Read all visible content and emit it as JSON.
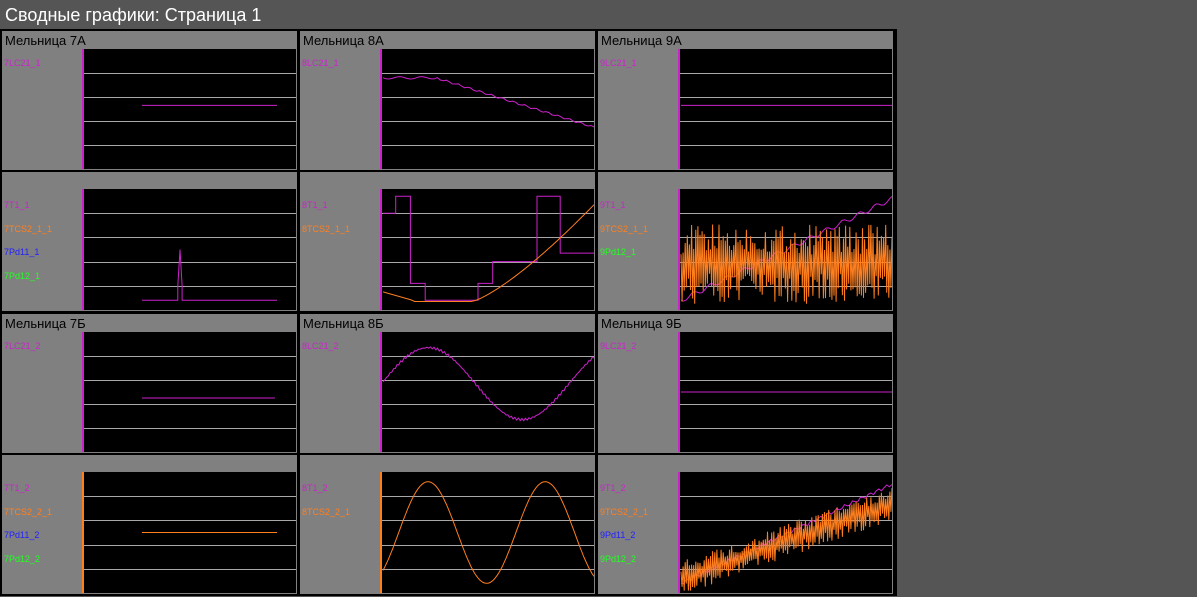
{
  "page": {
    "title": "Сводные графики: Страница 1"
  },
  "colors": {
    "background": "#555555",
    "panel": "#808080",
    "plot": "#000000",
    "grid": "#a8a8a8",
    "magenta": "#cc22cc",
    "orange": "#ff7f1f",
    "blue": "#2020ff",
    "green": "#22ff22"
  },
  "panels": [
    {
      "title": "Мельница 7А",
      "labels": [
        {
          "text": "7LC21_1",
          "color": "magenta"
        }
      ]
    },
    {
      "title": "Мельница 8А",
      "labels": [
        {
          "text": "8LC21_1",
          "color": "magenta"
        }
      ]
    },
    {
      "title": "Мельница 9А",
      "labels": [
        {
          "text": "9LC21_1",
          "color": "magenta"
        }
      ]
    },
    {
      "title": "",
      "labels": [
        {
          "text": "7T1_1",
          "color": "magenta"
        },
        {
          "text": "7TCS2_1_1",
          "color": "orange"
        },
        {
          "text": "7Pd11_1",
          "color": "blue"
        },
        {
          "text": "7Pd12_1",
          "color": "green"
        }
      ]
    },
    {
      "title": "",
      "labels": [
        {
          "text": "8T1_1",
          "color": "magenta"
        },
        {
          "text": "8TCS2_1_1",
          "color": "orange"
        }
      ]
    },
    {
      "title": "",
      "labels": [
        {
          "text": "9T1_1",
          "color": "magenta"
        },
        {
          "text": "9TCS2_1_1",
          "color": "orange"
        },
        {
          "text": "9Pd12_1",
          "color": "green"
        }
      ]
    },
    {
      "title": "Мельница 7Б",
      "labels": [
        {
          "text": "7LC21_2",
          "color": "magenta"
        }
      ]
    },
    {
      "title": "Мельница 8Б",
      "labels": [
        {
          "text": "8LC21_2",
          "color": "magenta"
        }
      ]
    },
    {
      "title": "Мельница 9Б",
      "labels": [
        {
          "text": "9LC21_2",
          "color": "magenta"
        }
      ]
    },
    {
      "title": "",
      "labels": [
        {
          "text": "7T1_2",
          "color": "magenta"
        },
        {
          "text": "7TCS2_2_1",
          "color": "orange"
        },
        {
          "text": "7Pd11_2",
          "color": "blue"
        },
        {
          "text": "7Pd12_2",
          "color": "green"
        }
      ]
    },
    {
      "title": "",
      "labels": [
        {
          "text": "8T1_2",
          "color": "magenta"
        },
        {
          "text": "8TCS2_2_1",
          "color": "orange"
        }
      ]
    },
    {
      "title": "",
      "labels": [
        {
          "text": "9T1_2",
          "color": "magenta"
        },
        {
          "text": "9TCS2_2_1",
          "color": "orange"
        },
        {
          "text": "9Pd11_2",
          "color": "blue"
        },
        {
          "text": "9Pd12_2",
          "color": "green"
        }
      ]
    }
  ]
}
